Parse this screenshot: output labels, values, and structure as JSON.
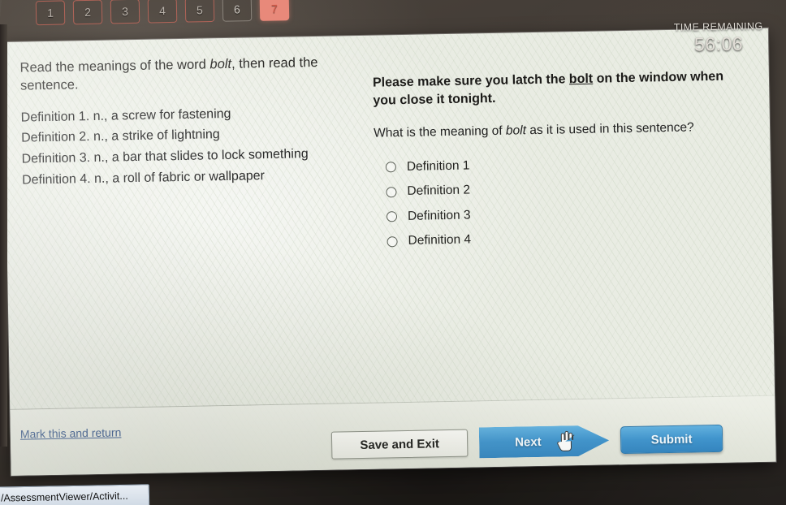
{
  "header": {
    "tabs": [
      {
        "label": "1",
        "state": "red-outline"
      },
      {
        "label": "2",
        "state": "red-outline"
      },
      {
        "label": "3",
        "state": "red-outline"
      },
      {
        "label": "4",
        "state": "red-outline"
      },
      {
        "label": "5",
        "state": "red-outline"
      },
      {
        "label": "6",
        "state": "gray-outline"
      },
      {
        "label": "7",
        "state": "active"
      }
    ],
    "timer_label": "TIME REMAINING",
    "timer_value": "56:06"
  },
  "left_panel": {
    "prompt_before": "Read the meanings of the word ",
    "prompt_word": "bolt",
    "prompt_after": ", then read the sentence.",
    "definitions": [
      "Definition 1. n., a  screw for fastening",
      "Definition 2. n., a strike of lightning",
      "Definition 3. n., a bar that slides to lock something",
      "Definition 4. n., a roll of fabric or wallpaper"
    ]
  },
  "right_panel": {
    "sentence_before": "Please make sure you latch the ",
    "sentence_word": "bolt",
    "sentence_after": " on the window when you close it tonight.",
    "question_before": "What is the meaning of ",
    "question_word": "bolt",
    "question_after": " as it is used in this sentence?",
    "choices": [
      {
        "label": "Definition 1",
        "selected": false
      },
      {
        "label": "Definition 2",
        "selected": false
      },
      {
        "label": "Definition 3",
        "selected": false
      },
      {
        "label": "Definition 4",
        "selected": false
      }
    ]
  },
  "footer": {
    "mark_link": "Mark this and return",
    "save_exit_label": "Save and Exit",
    "next_label": "Next",
    "submit_label": "Submit"
  },
  "taskbar": {
    "item_label": "/AssessmentViewer/Activit..."
  },
  "colors": {
    "panel_bg": "#e9ece3",
    "accent_blue": "#3f95cf",
    "active_tab": "#e8897a",
    "link_blue": "#2b4d86",
    "backdrop": "#3b3530"
  }
}
